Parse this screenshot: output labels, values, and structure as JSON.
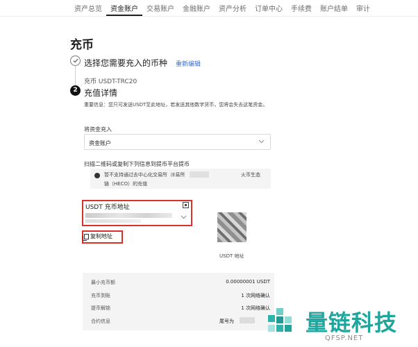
{
  "nav": {
    "tabs": [
      "资产总览",
      "资金账户",
      "交易账户",
      "金融账户",
      "资产分析",
      "订单中心",
      "手续费",
      "账户结单",
      "审计"
    ],
    "active_index": 1
  },
  "page": {
    "title": "充币"
  },
  "step1": {
    "title": "选择您需要充入的币种",
    "edit_label": "重新编辑",
    "summary": "充币 USDT-TRC20"
  },
  "step2": {
    "number": "2",
    "title": "充值详情",
    "notice": "重要信息：您只可发送USDT至此地址，若发送其他数字货币，您将会失去这笔资金。"
  },
  "deposit_into": {
    "label": "将资金充入",
    "selected": "资金账户"
  },
  "scan_label": "扫描二维码或复制下列信息到提币平台提币",
  "warning": {
    "line1_a": "暂不支持通过去中心化交易所（E易所",
    "line1_b": "火币生态",
    "line2": "链（HECO）的充值"
  },
  "address": {
    "label": "USDT 充币地址",
    "copy_label": "复制地址",
    "qr_caption": "USDT 地址"
  },
  "details": [
    {
      "key": "最小充币额",
      "value": "0.00000001 USDT"
    },
    {
      "key": "充币到账",
      "value": "1 次网络确认"
    },
    {
      "key": "提币解锁",
      "value": "1 次网络确认"
    },
    {
      "key": "合约信息",
      "value": "尾号为"
    }
  ],
  "watermark": {
    "title": "量链科技",
    "sub": "QFSP.NET"
  },
  "colors": {
    "highlight": "#d9302c",
    "link": "#3b6fd6",
    "brand": "#1fa59d"
  }
}
